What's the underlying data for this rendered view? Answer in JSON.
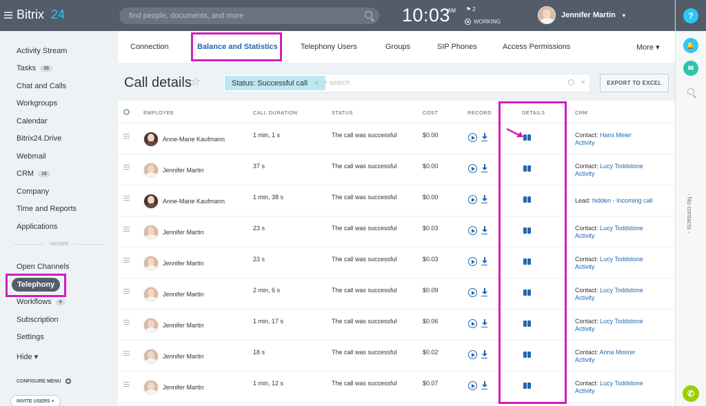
{
  "topbar": {
    "logo_text": "Bitrix",
    "logo_suffix": "24",
    "search_placeholder": "find people, documents, and more",
    "time": "10:03",
    "ampm": "AM",
    "flag_count": "2",
    "status": "WORKING",
    "user_name": "Jennifer Martin"
  },
  "sidebar": {
    "items": [
      {
        "label": "Activity Stream"
      },
      {
        "label": "Tasks",
        "badge": "39"
      },
      {
        "label": "Chat and Calls"
      },
      {
        "label": "Workgroups"
      },
      {
        "label": "Calendar"
      },
      {
        "label": "Bitrix24.Drive"
      },
      {
        "label": "Webmail"
      },
      {
        "label": "CRM",
        "badge": "16"
      },
      {
        "label": "Company"
      },
      {
        "label": "Time and Reports"
      },
      {
        "label": "Applications"
      }
    ],
    "hidden_label": "HIDDEN",
    "hidden_items": [
      {
        "label": "Open Channels"
      },
      {
        "label": "Telephony"
      },
      {
        "label": "Workflows",
        "badge": "4"
      },
      {
        "label": "Subscription"
      },
      {
        "label": "Settings"
      },
      {
        "label": "Hide ▾"
      }
    ],
    "configure_menu": "CONFIGURE MENU",
    "invite_users": "INVITE USERS  +"
  },
  "tabs": [
    {
      "label": "Connection"
    },
    {
      "label": "Balance and Statistics"
    },
    {
      "label": "Telephony Users"
    },
    {
      "label": "Groups"
    },
    {
      "label": "SIP Phones"
    },
    {
      "label": "Access Permissions"
    },
    {
      "label": "More ▾"
    }
  ],
  "page": {
    "title": "Call details",
    "star": "☆",
    "filter_chip": "Status: Successful call",
    "filter_chip_close": "×",
    "search_placeholder": "+ search",
    "clear": "×",
    "export_label": "EXPORT TO EXCEL"
  },
  "table": {
    "columns": [
      "EMPLOYEE",
      "CALL DURATION",
      "STATUS",
      "COST",
      "RECORD",
      "DETAILS",
      "CRM"
    ],
    "rows": [
      {
        "employee": "Anne-Marie Kaufmann",
        "duration": "1 min, 1 s",
        "status": "The call was successful",
        "cost": "$0.00",
        "crm_prefix": "Contact: ",
        "crm_link": "Hans Meier",
        "crm_activity": "Activity",
        "dark": true
      },
      {
        "employee": "Jennifer Martin",
        "duration": "37 s",
        "status": "The call was successful",
        "cost": "$0.00",
        "crm_prefix": "Contact: ",
        "crm_link": "Lucy Toddstone",
        "crm_activity": "Activity",
        "dark": false
      },
      {
        "employee": "Anne-Marie Kaufmann",
        "duration": "1 min, 38 s",
        "status": "The call was successful",
        "cost": "$0.00",
        "crm_prefix": "Lead: ",
        "crm_link": "hidden - Incoming call",
        "crm_activity": "",
        "dark": true
      },
      {
        "employee": "Jennifer Martin",
        "duration": "23 s",
        "status": "The call was successful",
        "cost": "$0.03",
        "crm_prefix": "Contact: ",
        "crm_link": "Lucy Toddstone",
        "crm_activity": "Activity",
        "dark": false
      },
      {
        "employee": "Jennifer Martin",
        "duration": "23 s",
        "status": "The call was successful",
        "cost": "$0.03",
        "crm_prefix": "Contact: ",
        "crm_link": "Lucy Toddstone",
        "crm_activity": "Activity",
        "dark": false
      },
      {
        "employee": "Jennifer Martin",
        "duration": "2 min, 6 s",
        "status": "The call was successful",
        "cost": "$0.09",
        "crm_prefix": "Contact: ",
        "crm_link": "Lucy Toddstone",
        "crm_activity": "Activity",
        "dark": false
      },
      {
        "employee": "Jennifer Martin",
        "duration": "1 min, 17 s",
        "status": "The call was successful",
        "cost": "$0.06",
        "crm_prefix": "Contact: ",
        "crm_link": "Lucy Toddstone",
        "crm_activity": "Activity",
        "dark": false
      },
      {
        "employee": "Jennifer Martin",
        "duration": "18 s",
        "status": "The call was successful",
        "cost": "$0.02",
        "crm_prefix": "Contact: ",
        "crm_link": "Anna Moorer",
        "crm_activity": "Activity",
        "dark": false
      },
      {
        "employee": "Jennifer Martin",
        "duration": "1 min, 12 s",
        "status": "The call was successful",
        "cost": "$0.07",
        "crm_prefix": "Contact: ",
        "crm_link": "Lucy Toddstone",
        "crm_activity": "Activity",
        "dark": false
      }
    ]
  },
  "rightbar": {
    "help": "?",
    "no_contacts": "- No contacts -"
  },
  "colors": {
    "highlight": "#d11bc1",
    "link": "#2067b0",
    "topbar": "#535c69",
    "accent": "#2fc6f6"
  }
}
